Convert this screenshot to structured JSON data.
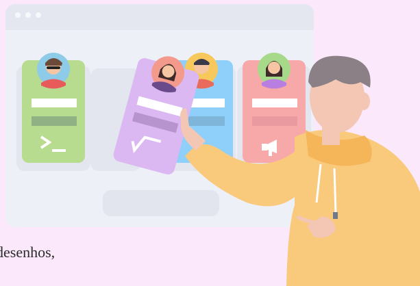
{
  "caption": {
    "text": "desenhos,"
  },
  "colors": {
    "background": "#fbe9fb",
    "window": "#eef0f7",
    "window_bar": "#e3e6ef",
    "card_green": "#b7dc8f",
    "card_purple": "#dcb8f3",
    "card_blue": "#8fd0fb",
    "card_red": "#f7a8a8",
    "hoodie": "#f9c97c"
  },
  "icons": {
    "card_green": "terminal-prompt-icon",
    "card_purple": "square-root-icon",
    "card_red": "megaphone-icon"
  }
}
